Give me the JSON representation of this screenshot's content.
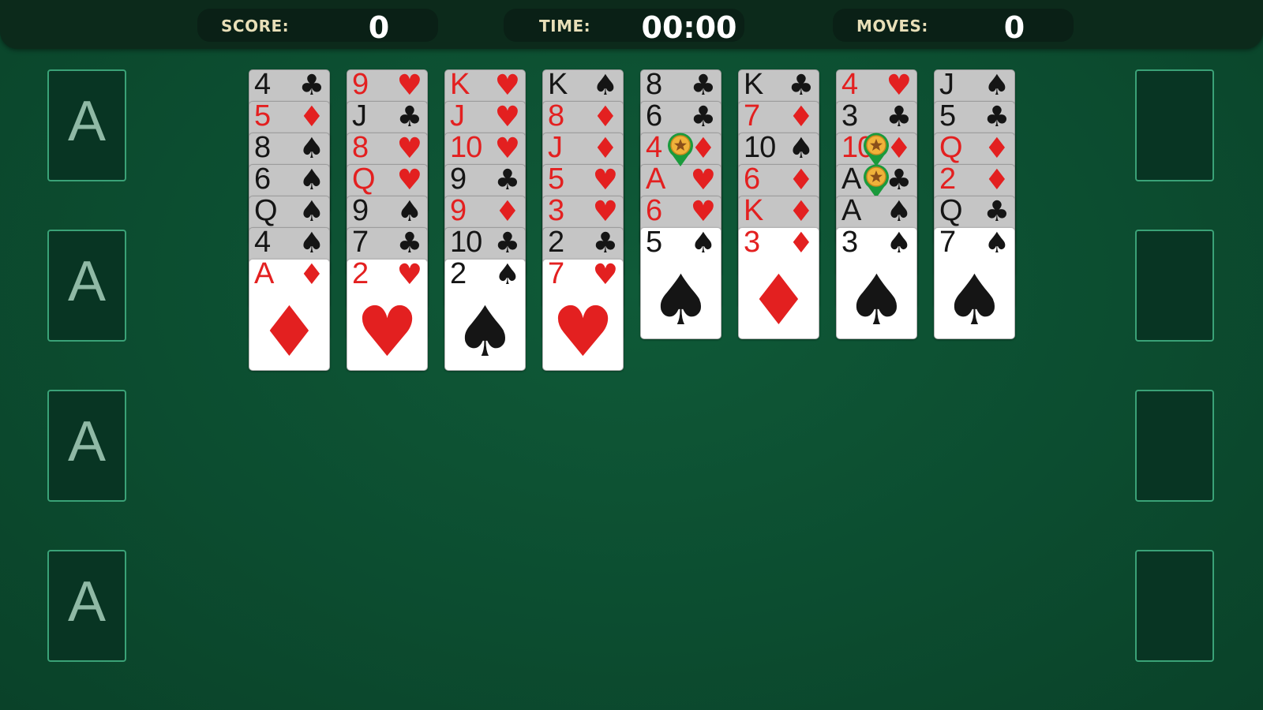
{
  "hud": {
    "score_label": "SCORE:",
    "score_value": "0",
    "time_label": "TIME:",
    "time_value": "00:00",
    "moves_label": "MOVES:",
    "moves_value": "0"
  },
  "foundations": [
    {
      "label": "A"
    },
    {
      "label": "A"
    },
    {
      "label": "A"
    },
    {
      "label": "A"
    }
  ],
  "free_cells": [
    {},
    {},
    {},
    {}
  ],
  "columns": [
    [
      {
        "r": "4",
        "s": "♣"
      },
      {
        "r": "5",
        "s": "♦"
      },
      {
        "r": "8",
        "s": "♠"
      },
      {
        "r": "6",
        "s": "♠"
      },
      {
        "r": "Q",
        "s": "♠"
      },
      {
        "r": "4",
        "s": "♠",
        "hint": true
      },
      {
        "r": "A",
        "s": "♦"
      }
    ],
    [
      {
        "r": "9",
        "s": "♥"
      },
      {
        "r": "J",
        "s": "♣"
      },
      {
        "r": "8",
        "s": "♥"
      },
      {
        "r": "Q",
        "s": "♥"
      },
      {
        "r": "9",
        "s": "♠"
      },
      {
        "r": "7",
        "s": "♣"
      },
      {
        "r": "2",
        "s": "♥"
      }
    ],
    [
      {
        "r": "K",
        "s": "♥"
      },
      {
        "r": "J",
        "s": "♥"
      },
      {
        "r": "10",
        "s": "♥"
      },
      {
        "r": "9",
        "s": "♣"
      },
      {
        "r": "9",
        "s": "♦"
      },
      {
        "r": "10",
        "s": "♣"
      },
      {
        "r": "2",
        "s": "♠"
      }
    ],
    [
      {
        "r": "K",
        "s": "♠"
      },
      {
        "r": "8",
        "s": "♦"
      },
      {
        "r": "J",
        "s": "♦"
      },
      {
        "r": "5",
        "s": "♥"
      },
      {
        "r": "3",
        "s": "♥"
      },
      {
        "r": "2",
        "s": "♣"
      },
      {
        "r": "7",
        "s": "♥"
      }
    ],
    [
      {
        "r": "8",
        "s": "♣"
      },
      {
        "r": "6",
        "s": "♣"
      },
      {
        "r": "4",
        "s": "♦",
        "hint": true
      },
      {
        "r": "A",
        "s": "♥"
      },
      {
        "r": "6",
        "s": "♥"
      },
      {
        "r": "5",
        "s": "♠"
      }
    ],
    [
      {
        "r": "K",
        "s": "♣"
      },
      {
        "r": "7",
        "s": "♦"
      },
      {
        "r": "10",
        "s": "♠"
      },
      {
        "r": "6",
        "s": "♦"
      },
      {
        "r": "K",
        "s": "♦"
      },
      {
        "r": "3",
        "s": "♦"
      }
    ],
    [
      {
        "r": "4",
        "s": "♥"
      },
      {
        "r": "3",
        "s": "♣"
      },
      {
        "r": "10",
        "s": "♦",
        "hint": true
      },
      {
        "r": "A",
        "s": "♣",
        "hint": true
      },
      {
        "r": "A",
        "s": "♠"
      },
      {
        "r": "3",
        "s": "♠"
      }
    ],
    [
      {
        "r": "J",
        "s": "♠"
      },
      {
        "r": "5",
        "s": "♣"
      },
      {
        "r": "Q",
        "s": "♦"
      },
      {
        "r": "2",
        "s": "♦"
      },
      {
        "r": "Q",
        "s": "♣"
      },
      {
        "r": "7",
        "s": "♠"
      }
    ]
  ],
  "colors": {
    "felt": "#0c4d30",
    "red_suit": "#e32020",
    "black_suit": "#151515",
    "slot_border": "#3aa277",
    "hint_pin": "#1a9a3c",
    "hint_star": "#f0b23a"
  }
}
